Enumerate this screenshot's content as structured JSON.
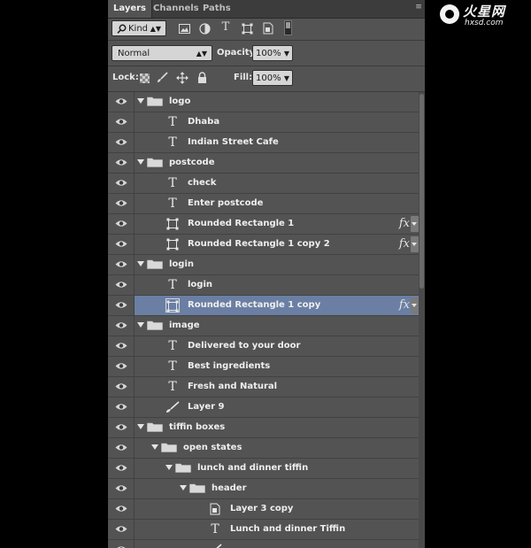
{
  "panel": {
    "tabs": [
      {
        "label": "Layers",
        "active": true
      },
      {
        "label": "Channels",
        "active": false
      },
      {
        "label": "Paths",
        "active": false
      }
    ],
    "menu_icon": "panel-menu-icon"
  },
  "filter": {
    "kind_label": "Kind",
    "kind_icon": "search-icon",
    "filter_icons": [
      "image-filter-icon",
      "adjustment-filter-icon",
      "type-filter-icon",
      "shape-filter-icon",
      "smart-object-filter-icon",
      "filter-toggle-switch"
    ]
  },
  "blend": {
    "mode": "Normal",
    "opacity_label": "Opacity:",
    "opacity_value": "100%"
  },
  "lock": {
    "label": "Lock:",
    "lock_icons": [
      "lock-transparent-icon",
      "lock-image-icon",
      "lock-position-icon",
      "lock-all-icon"
    ],
    "fill_label": "Fill:",
    "fill_value": "100%"
  },
  "layers": [
    {
      "name": "logo",
      "type": "group",
      "depth": 0
    },
    {
      "name": "Dhaba",
      "type": "text",
      "depth": 1
    },
    {
      "name": "Indian Street Cafe",
      "type": "text",
      "depth": 1
    },
    {
      "name": "postcode",
      "type": "group",
      "depth": 0
    },
    {
      "name": "check",
      "type": "text",
      "depth": 1
    },
    {
      "name": "Enter postcode",
      "type": "text",
      "depth": 1
    },
    {
      "name": "Rounded Rectangle 1",
      "type": "shape",
      "depth": 1,
      "fx": true
    },
    {
      "name": "Rounded Rectangle 1 copy 2",
      "type": "shape",
      "depth": 1,
      "fx": true
    },
    {
      "name": "login",
      "type": "group",
      "depth": 0
    },
    {
      "name": "login",
      "type": "text",
      "depth": 1
    },
    {
      "name": "Rounded Rectangle 1 copy",
      "type": "shape",
      "depth": 1,
      "fx": true,
      "selected": true
    },
    {
      "name": "image",
      "type": "group",
      "depth": 0
    },
    {
      "name": "Delivered to your door",
      "type": "text",
      "depth": 1
    },
    {
      "name": "Best ingredients",
      "type": "text",
      "depth": 1
    },
    {
      "name": "Fresh and Natural",
      "type": "text",
      "depth": 1
    },
    {
      "name": "Layer 9",
      "type": "brush",
      "depth": 1
    },
    {
      "name": "tiffin boxes",
      "type": "group",
      "depth": 0
    },
    {
      "name": "open states",
      "type": "group",
      "depth": 1
    },
    {
      "name": "lunch and dinner tiffin",
      "type": "group",
      "depth": 2
    },
    {
      "name": "header",
      "type": "group",
      "depth": 3
    },
    {
      "name": "Layer 3 copy",
      "type": "smartobject",
      "depth": 4
    },
    {
      "name": "Lunch and dinner Tiffin",
      "type": "text",
      "depth": 4
    },
    {
      "name": "",
      "type": "brush",
      "depth": 4
    }
  ],
  "fx_label": "fx",
  "text_glyph": "T",
  "watermark": {
    "brand": "火星网",
    "site": "hxsd.com"
  },
  "colors": {
    "panel_bg": "#535353",
    "selected_row": "#6a7fa3",
    "tab_bar": "#3c3c3c"
  }
}
